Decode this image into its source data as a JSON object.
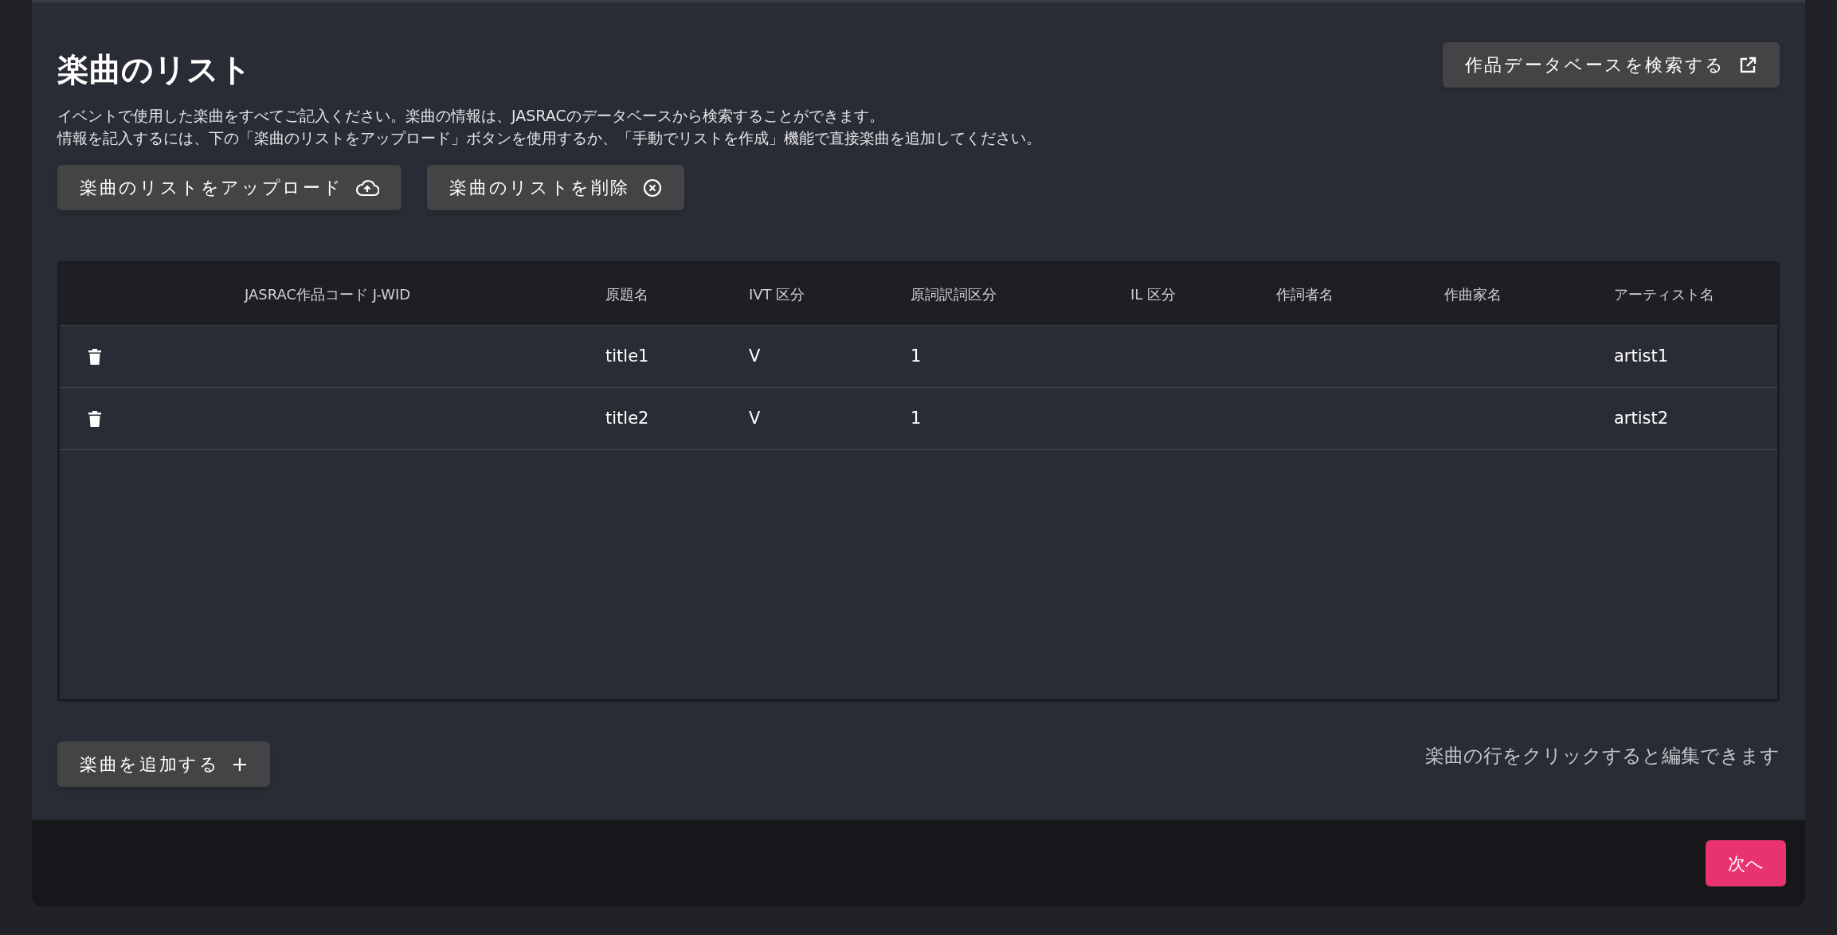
{
  "header": {
    "title": "楽曲のリスト",
    "search_button": "作品データベースを検索する"
  },
  "description": [
    "イベントで使用した楽曲をすべてご記入ください。楽曲の情報は、JASRACのデータベースから検索することができます。",
    "情報を記入するには、下の「楽曲のリストをアップロード」ボタンを使用するか、「手動でリストを作成」機能で直接楽曲を追加してください。"
  ],
  "actions": [
    {
      "label": "楽曲のリストをアップロード",
      "kind": "upload"
    },
    {
      "label": "楽曲のリストを削除",
      "kind": "delete"
    }
  ],
  "table": {
    "columns": [
      "JASRAC作品コード J-WID",
      "原題名",
      "IVT 区分",
      "原詞訳詞区分",
      "IL 区分",
      "作詞者名",
      "作曲家名",
      "アーティスト名"
    ],
    "rows": [
      {
        "cells": [
          null,
          "title1",
          "V",
          "1",
          null,
          null,
          null,
          "artist1"
        ]
      },
      {
        "cells": [
          null,
          "title2",
          "V",
          "1",
          null,
          null,
          null,
          "artist2"
        ]
      }
    ]
  },
  "add_button": "楽曲を追加する",
  "hint": "楽曲の行をクリックすると編集できます",
  "footer": {
    "next_button": "次へ"
  }
}
